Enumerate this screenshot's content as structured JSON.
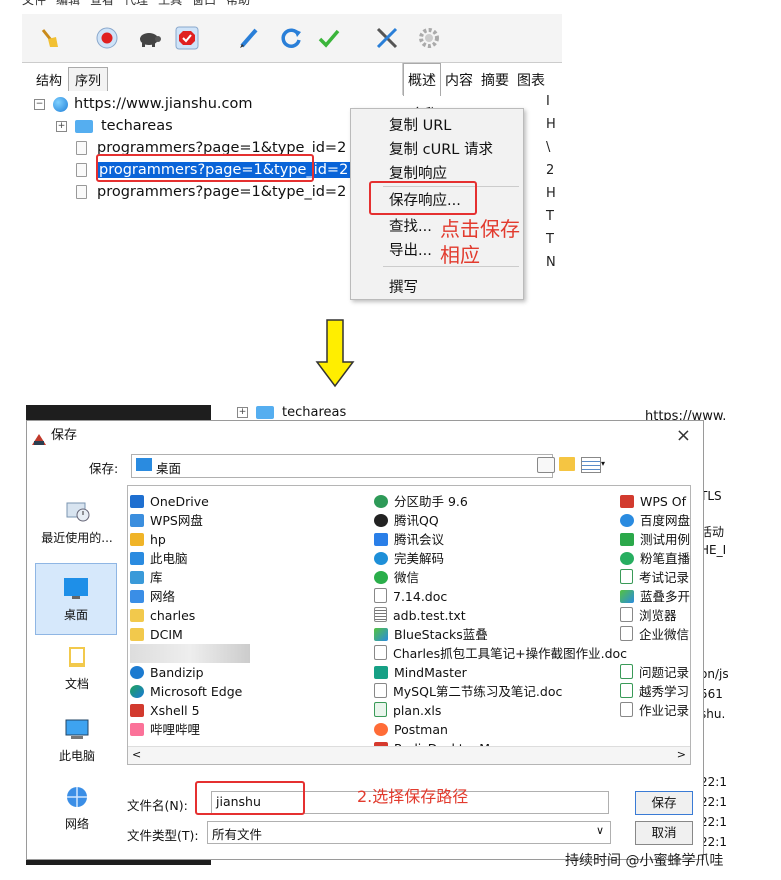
{
  "top": {
    "menu": [
      "文件",
      "编辑",
      "查看",
      "代理",
      "工具",
      "窗口",
      "帮助"
    ],
    "tabs_left": [
      "结构",
      "序列"
    ],
    "tabs_right": [
      "概述",
      "内容",
      "摘要",
      "图表"
    ],
    "tree": {
      "root": "https://www.jianshu.com",
      "folder": "techareas",
      "items": [
        "programmers?page=1&type_id=2",
        "programmers?page=1&type_id=2",
        "programmers?page=1&type_id=2"
      ]
    },
    "right_header": "名称",
    "context_menu": [
      "复制 URL",
      "复制 cURL 请求",
      "复制响应",
      "保存响应...",
      "查找...",
      "导出...",
      "撰写"
    ],
    "annotation": "点击保存\n相应"
  },
  "dialog": {
    "bg_folder": "techareas",
    "bg_url": "https://www.",
    "title": "保存",
    "close": "×",
    "save_in_label": "保存:",
    "save_in_value": "桌面",
    "places": [
      "最近使用的...",
      "桌面",
      "文档",
      "此电脑",
      "网络"
    ],
    "files_col1": [
      "OneDrive",
      "WPS网盘",
      "hp",
      "此电脑",
      "库",
      "网络",
      "charles",
      "DCIM",
      "",
      "Bandizip",
      "Microsoft Edge",
      "Xshell 5",
      "哔哩哔哩"
    ],
    "files_col2": [
      "分区助手 9.6",
      "腾讯QQ",
      "腾讯会议",
      "完美解码",
      "微信",
      "7.14.doc",
      "adb.test.txt",
      "BlueStacks蓝叠",
      "Charles抓包工具笔记+操作截图作业.doc",
      "MindMaster",
      "MySQL第二节练习及笔记.doc",
      "plan.xls",
      "Postman",
      "RedisDesktopManager"
    ],
    "files_col3": [
      "WPS Of",
      "百度网盘",
      "测试用例",
      "粉笔直播",
      "考试记录",
      "蓝叠多开",
      "浏览器",
      "企业微信",
      "问题记录",
      "越秀学习",
      "作业记录"
    ],
    "filename_label": "文件名(N):",
    "filename_value": "jianshu",
    "filetype_label": "文件类型(T):",
    "filetype_value": "所有文件",
    "save_button": "保存",
    "cancel_button": "取消",
    "annotation": "2.选择保存路径"
  },
  "behind_right": [
    "TLS",
    "活动",
    "HE_I",
    "on/js",
    "561",
    "shu.",
    "22:1",
    "22:1",
    "22:1",
    "22:1"
  ],
  "watermark": "持续时间 @小蜜蜂学爪哇",
  "colors": {
    "accent_red": "#e53030",
    "selection": "#0a64d8",
    "arrow": "#ffee00"
  }
}
